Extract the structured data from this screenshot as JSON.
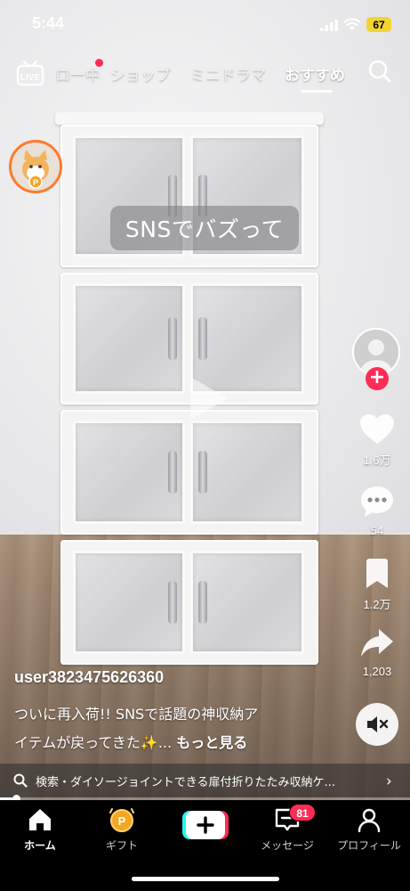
{
  "status_bar": {
    "time": "5:44",
    "battery": "67"
  },
  "top_nav": {
    "live_label": "LIVE",
    "tabs": [
      {
        "label": "フォロー中"
      },
      {
        "label": "ショップ"
      },
      {
        "label": "ミニドラマ"
      },
      {
        "label": "おすすめ"
      }
    ],
    "active_tab": "おすすめ"
  },
  "video": {
    "overlay_caption": "SNSでバズって"
  },
  "right_rail": {
    "like_count": "1.6万",
    "comment_count": "54",
    "save_count": "1.2万",
    "share_count": "1,203"
  },
  "caption": {
    "username": "user3823475626360",
    "line1": "ついに再入荷!! SNSで話題の神収納ア",
    "line2": "イテムが戻ってきた✨... ",
    "more": "もっと見る"
  },
  "search_suggestion": {
    "text": "検索・ダイソージョイントできる扉付折りたたみ収納ケ..."
  },
  "progress": {
    "fraction": 0.04
  },
  "tab_bar": {
    "home": "ホーム",
    "gift": "ギフト",
    "messages": "メッセージ",
    "messages_badge": "81",
    "profile": "プロフィール"
  },
  "colors": {
    "accent": "#fe2c55",
    "coin_border": "#ff7a2e",
    "battery": "#f1d432"
  }
}
